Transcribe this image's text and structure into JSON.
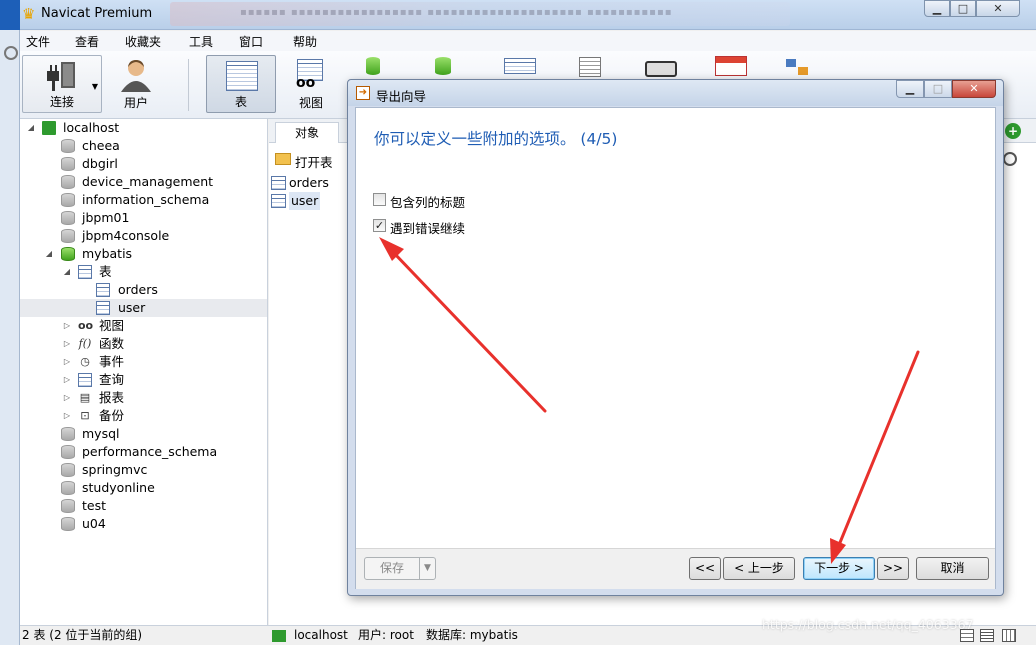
{
  "window": {
    "title": "Navicat Premium",
    "controls": {
      "minimize": "▁",
      "maximize": "□",
      "close": "✕"
    }
  },
  "menu": [
    "文件",
    "查看",
    "收藏夹",
    "工具",
    "窗口",
    "帮助"
  ],
  "toolbar": {
    "connect": "连接",
    "user": "用户",
    "table": "表",
    "view": "视图"
  },
  "tree": {
    "connection": "localhost",
    "databases": [
      "cheea",
      "dbgirl",
      "device_management",
      "information_schema",
      "jbpm01",
      "jbpm4console"
    ],
    "open_db": "mybatis",
    "table_group": "表",
    "tables": [
      "orders",
      "user"
    ],
    "groups": [
      "视图",
      "函数",
      "事件",
      "查询",
      "报表",
      "备份"
    ],
    "databases_after": [
      "mysql",
      "performance_schema",
      "springmvc",
      "studyonline",
      "test",
      "u04"
    ]
  },
  "objects": {
    "tab": "对象",
    "open_table": "打开表",
    "items": [
      "orders",
      "user"
    ]
  },
  "status": {
    "left": "2 表 (2 位于当前的组)",
    "connection": "localhost",
    "user": "用户: root",
    "database": "数据库: mybatis"
  },
  "watermark": "https://blog.csdn.net/qq_4063367",
  "dialog": {
    "title": "导出向导",
    "heading": "你可以定义一些附加的选项。 (4/5)",
    "option_header": "包含列的标题",
    "option_header_checked": false,
    "option_continue": "遇到错误继续",
    "option_continue_checked": true,
    "buttons": {
      "save": "保存",
      "first": "<<",
      "prev": "< 上一步",
      "next": "下一步 >",
      "last": ">>",
      "cancel": "取消"
    }
  },
  "colors": {
    "heading": "#1f5db4",
    "arrow": "#e8312c",
    "db_active": "#41a31d"
  }
}
